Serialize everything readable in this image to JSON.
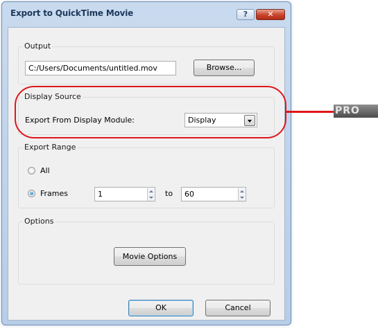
{
  "window": {
    "title": "Export to QuickTime Movie",
    "help_label": "?",
    "close_label": "✕"
  },
  "output": {
    "group_label": "Output",
    "path_value": "C:/Users/Documents/untitled.mov",
    "browse_label": "Browse..."
  },
  "display_source": {
    "group_label": "Display Source",
    "module_label": "Export From Display Module:",
    "module_selected": "Display"
  },
  "export_range": {
    "group_label": "Export Range",
    "all_label": "All",
    "frames_label": "Frames",
    "selected_option": "Frames",
    "from_value": "1",
    "to_label": "to",
    "to_value": "60"
  },
  "options": {
    "group_label": "Options",
    "movie_options_label": "Movie Options"
  },
  "buttons": {
    "ok_label": "OK",
    "cancel_label": "Cancel"
  },
  "annotation": {
    "badge_text": "PRO",
    "highlight_color": "#e0151b"
  }
}
